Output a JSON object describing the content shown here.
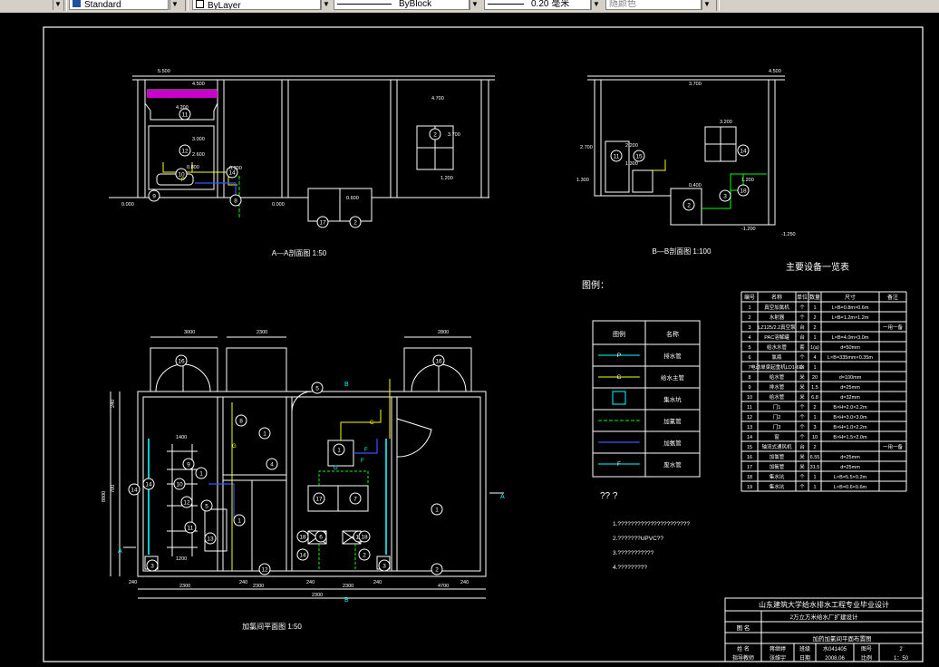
{
  "toolbar": {
    "style_value": "Standard",
    "layer_value": "ByLayer",
    "linetype_value": "ByBlock",
    "lineweight_value": "0.20 毫米",
    "color_value": "随颜色"
  },
  "section_aa": {
    "title": "A—A剖面图  1:50",
    "dims": [
      "5.500",
      "4.500",
      "4.200",
      "3.000",
      "2.600",
      "0.800",
      "0.600",
      "0.000",
      "0.000",
      "0.300",
      "4.700",
      "3.700",
      "1.200"
    ],
    "callouts": [
      "11",
      "12",
      "10",
      "9",
      "8",
      "17",
      "2",
      "2",
      "14"
    ]
  },
  "section_bb": {
    "title": "B—B剖面图  1:100",
    "dims": [
      "4.500",
      "3.700",
      "3.200",
      "2.700",
      "2.200",
      "1.300",
      "1.200",
      "1.300",
      "0.400",
      "-1.200",
      "-1.250"
    ],
    "callouts": [
      "11",
      "15",
      "14",
      "2",
      "3",
      "18"
    ]
  },
  "plan": {
    "title": "加氯间平面图  1:50",
    "dims": [
      "3000",
      "2300",
      "2800",
      "2300",
      "2300",
      "1400",
      "1200",
      "2300",
      "4700",
      "2300",
      "13400",
      "8800",
      "700",
      "240",
      "240",
      "240",
      "240",
      "240",
      "240"
    ],
    "callouts": [
      "16",
      "16",
      "1",
      "1",
      "1",
      "5",
      "4",
      "1",
      "12",
      "5",
      "13",
      "1",
      "17",
      "7",
      "6",
      "14",
      "14",
      "2",
      "2",
      "3",
      "3",
      "18",
      "18",
      "14",
      "14",
      "11",
      "9",
      "10",
      "12",
      "8"
    ],
    "markers": [
      "A",
      "A",
      "B",
      "B",
      "A",
      "B"
    ],
    "pipe_labels": [
      "G",
      "G",
      "F",
      "F",
      "G",
      "P"
    ]
  },
  "legend": {
    "heading": "图例：",
    "col_symbol": "图例",
    "col_name": "名称",
    "rows": [
      {
        "symbol": "P",
        "name": "排水管"
      },
      {
        "symbol": "G",
        "name": "给水主管"
      },
      {
        "symbol": "",
        "name": "集水坑"
      },
      {
        "symbol": "",
        "name": "加氯管"
      },
      {
        "symbol": "",
        "name": "加氨管"
      },
      {
        "symbol": "F",
        "name": "废水管"
      }
    ]
  },
  "notes": {
    "heading": "??  ?",
    "items": [
      "1.??????????????????????",
      "2.???????UPVC??",
      "3.???????????",
      "4.?????????"
    ]
  },
  "equipment_table": {
    "title": "主要设备一览表",
    "headers": [
      "编号",
      "名称",
      "单位",
      "数量",
      "尺寸",
      "备注"
    ],
    "rows": [
      [
        "1",
        "真空加氯机",
        "个",
        "1",
        "L×B=0.8m×0.6m",
        ""
      ],
      [
        "2",
        "水射器",
        "个",
        "2",
        "L×B=1.2m×1.2m",
        ""
      ],
      [
        "3",
        "LZ125/2.2真空泵",
        "台",
        "2",
        "",
        "一用一备"
      ],
      [
        "4",
        "PAC溶解罐",
        "台",
        "1",
        "L×B=4.0m×3.0m",
        ""
      ],
      [
        "5",
        "给水水管",
        "套",
        "1(a)",
        "d=50mm",
        ""
      ],
      [
        "6",
        "氯瓶",
        "个",
        "4",
        "L×B=335mm×0.35m",
        ""
      ],
      [
        "7",
        "电动单梁起重机LD1-6D",
        "台",
        "1",
        "",
        ""
      ],
      [
        "8",
        "给水管",
        "米",
        "20",
        "d=100mm",
        ""
      ],
      [
        "9",
        "排水管",
        "米",
        "1.5",
        "d=25mm",
        ""
      ],
      [
        "10",
        "给水管",
        "米",
        "6.8",
        "d=32mm",
        ""
      ],
      [
        "11",
        "门1",
        "个",
        "2",
        "B×H=2.0×2.2m",
        ""
      ],
      [
        "12",
        "门2",
        "个",
        "1",
        "B×H=3.0×3.0m",
        ""
      ],
      [
        "13",
        "门3",
        "个",
        "3",
        "B×H=1.0×2.2m",
        ""
      ],
      [
        "14",
        "窗",
        "个",
        "10",
        "B×H=1.5×2.0m",
        ""
      ],
      [
        "15",
        "轴流式通风机",
        "台",
        "2",
        "",
        "一用一备"
      ],
      [
        "16",
        "加氯管",
        "米",
        "6.55",
        "d=25mm",
        ""
      ],
      [
        "17",
        "加氨管",
        "米",
        "31.5",
        "d=25mm",
        ""
      ],
      [
        "18",
        "集水坑",
        "个",
        "1",
        "L×B=5.5×0.2m",
        ""
      ],
      [
        "19",
        "集水坑",
        "个",
        "1",
        "L×B=0.6×0.6m",
        ""
      ]
    ]
  },
  "title_block": {
    "school": "山东建筑大学给水排水工程专业毕业设计",
    "project": "2万立方米给水厂扩建设计",
    "label_drawing_name": "图 名",
    "drawing_name": "加药加氯间平面布置图",
    "row4": [
      "姓  名",
      "蒋继婷",
      "班级",
      "水041405",
      "图号",
      "2"
    ],
    "row5": [
      "指导教师",
      "张维宇",
      "日期",
      "2008.06",
      "比例",
      "1：50"
    ]
  }
}
